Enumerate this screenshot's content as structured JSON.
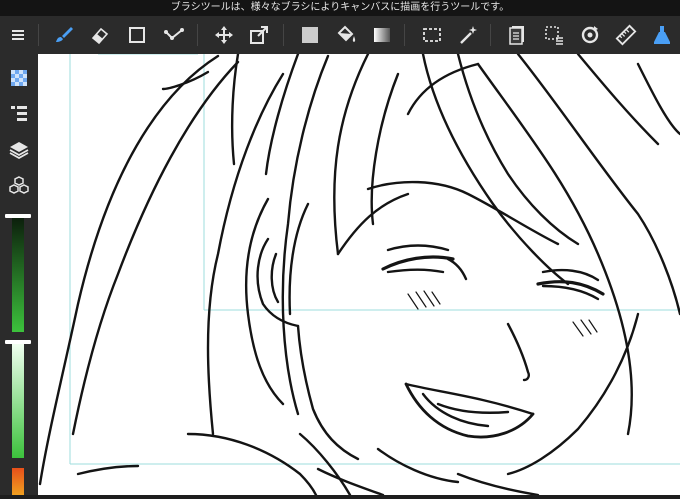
{
  "hint_bar": {
    "text": "ブラシツールは、様々なブラシによりキャンバスに描画を行うツールです。"
  },
  "toolbar": {
    "items": [
      {
        "name": "menu-icon",
        "kind": "menu"
      },
      {
        "name": "brush-tool-icon",
        "kind": "tool",
        "active": true
      },
      {
        "name": "eraser-tool-icon",
        "kind": "tool"
      },
      {
        "name": "shape-tool-icon",
        "kind": "tool"
      },
      {
        "name": "pen-stroke-tool-icon",
        "kind": "tool"
      },
      {
        "name": "move-tool-icon",
        "kind": "tool"
      },
      {
        "name": "transform-tool-icon",
        "kind": "tool"
      },
      {
        "name": "fill-color-icon",
        "kind": "tool"
      },
      {
        "name": "bucket-tool-icon",
        "kind": "tool"
      },
      {
        "name": "gradient-tool-icon",
        "kind": "tool"
      },
      {
        "name": "selection-tool-icon",
        "kind": "tool"
      },
      {
        "name": "magic-wand-tool-icon",
        "kind": "tool"
      },
      {
        "name": "copy-layer-icon",
        "kind": "action"
      },
      {
        "name": "select-menu-icon",
        "kind": "action"
      },
      {
        "name": "rotate-canvas-icon",
        "kind": "action"
      },
      {
        "name": "ruler-icon",
        "kind": "action"
      },
      {
        "name": "snap-icon",
        "kind": "action"
      }
    ]
  },
  "sidebar": {
    "items": [
      {
        "name": "material-icon"
      },
      {
        "name": "brush-list-icon"
      },
      {
        "name": "layers-icon"
      },
      {
        "name": "3d-objects-icon"
      }
    ],
    "brush_size": 0.6,
    "brush_opacity": 0.75
  },
  "colors": {
    "accent": "#4a9ff5",
    "toolbar_bg": "#2b2b2b",
    "canvas_bg": "#ffffff",
    "guide": "#9edede",
    "brush_color": "#3cc23c"
  }
}
